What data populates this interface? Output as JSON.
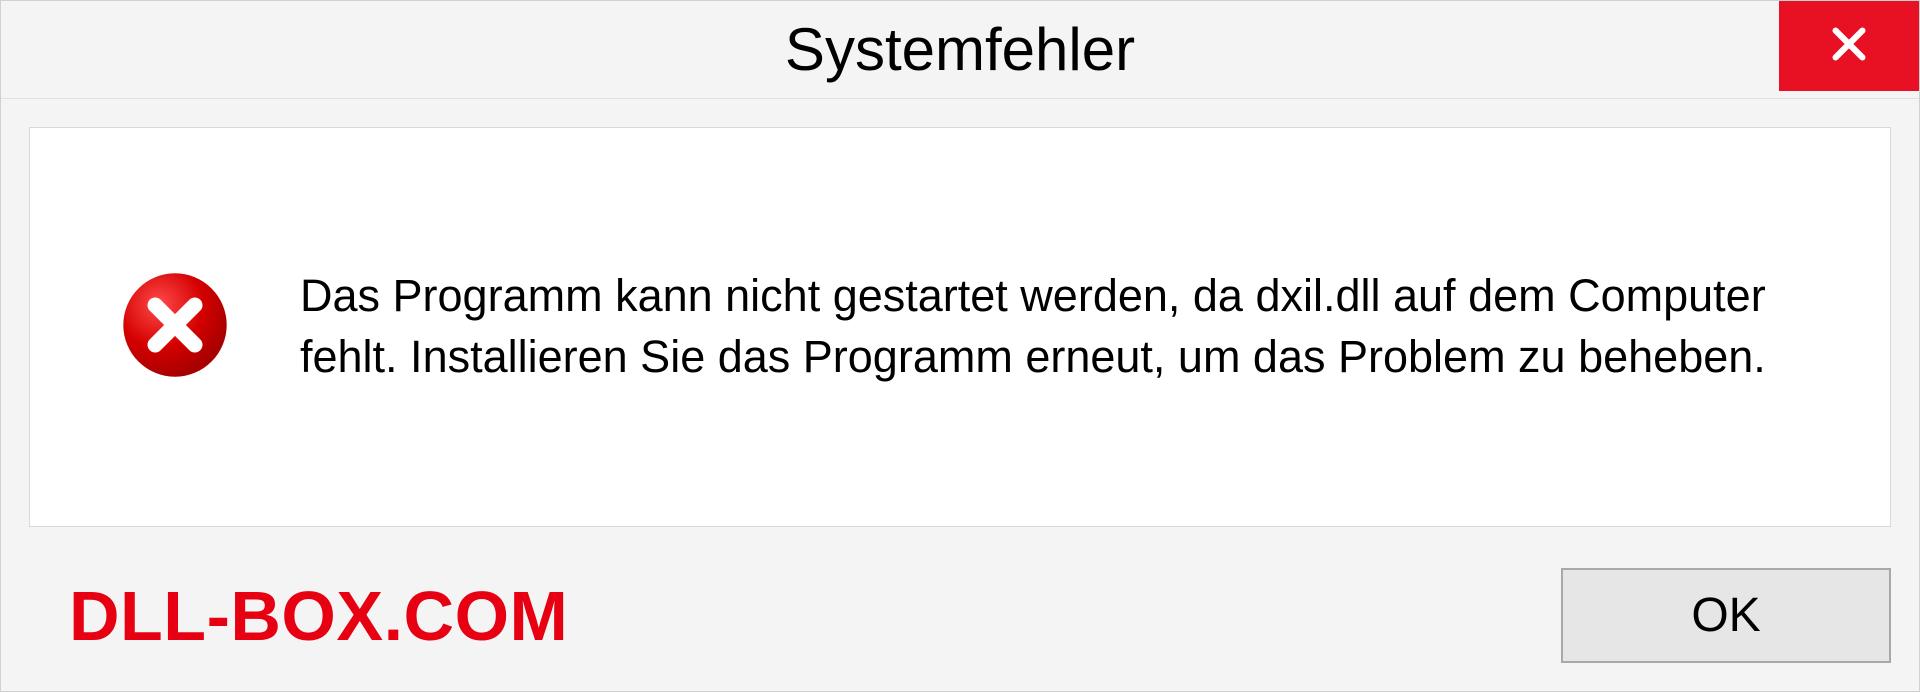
{
  "dialog": {
    "title": "Systemfehler",
    "message": "Das Programm kann nicht gestartet werden, da dxil.dll auf dem Computer fehlt. Installieren Sie das Programm erneut, um das Problem zu beheben.",
    "ok_label": "OK"
  },
  "watermark": "DLL-BOX.COM",
  "colors": {
    "close_bg": "#e81123",
    "error_icon": "#d40000",
    "watermark": "#e60012"
  }
}
